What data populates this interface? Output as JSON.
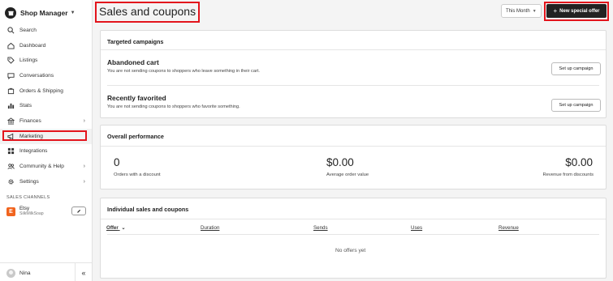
{
  "sidebar": {
    "brand": "Shop Manager",
    "items": [
      {
        "label": "Search",
        "icon": "search-icon"
      },
      {
        "label": "Dashboard",
        "icon": "home-icon"
      },
      {
        "label": "Listings",
        "icon": "listings-icon"
      },
      {
        "label": "Conversations",
        "icon": "chat-icon"
      },
      {
        "label": "Orders & Shipping",
        "icon": "orders-icon"
      },
      {
        "label": "Stats",
        "icon": "stats-icon"
      },
      {
        "label": "Finances",
        "icon": "finances-icon"
      },
      {
        "label": "Marketing",
        "icon": "megaphone-icon"
      },
      {
        "label": "Integrations",
        "icon": "grid-icon"
      },
      {
        "label": "Community & Help",
        "icon": "people-icon"
      },
      {
        "label": "Settings",
        "icon": "gear-icon"
      }
    ],
    "sales_channels_label": "SALES CHANNELS",
    "channel": {
      "name": "Etsy",
      "shop": "SilkMilkSoap",
      "badge": "E"
    },
    "user": "Nina",
    "collapse": "«"
  },
  "header": {
    "title": "Sales and coupons",
    "period": "This Month",
    "new_offer_label": "New special offer"
  },
  "targeted": {
    "title": "Targeted campaigns",
    "campaigns": [
      {
        "title": "Abandoned cart",
        "desc": "You are not sending coupons to shoppers who leave something in their cart.",
        "button": "Set up campaign"
      },
      {
        "title": "Recently favorited",
        "desc": "You are not sending coupons to shoppers who favorite something.",
        "button": "Set up campaign"
      }
    ]
  },
  "performance": {
    "title": "Overall performance",
    "stats": [
      {
        "value": "0",
        "label": "Orders with a discount"
      },
      {
        "value": "$0.00",
        "label": "Average order value"
      },
      {
        "value": "$0.00",
        "label": "Revenue from discounts"
      }
    ]
  },
  "individual": {
    "title": "Individual sales and coupons",
    "columns": [
      "Offer",
      "Duration",
      "Sends",
      "Uses",
      "Revenue"
    ],
    "sort_indicator": "⌄",
    "empty": "No offers yet"
  },
  "colors": {
    "highlight": "#e3141c",
    "etsy": "#f1641e",
    "primary": "#222222"
  }
}
